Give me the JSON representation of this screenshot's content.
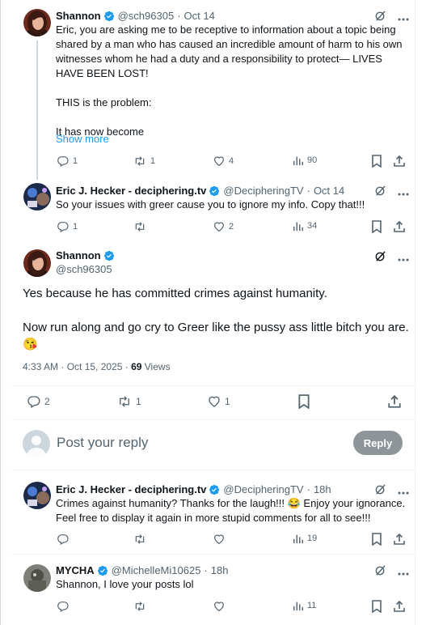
{
  "tweets": [
    {
      "name": "Shannon",
      "handle": "@sch96305",
      "dot": "·",
      "time": "Oct 14",
      "text": "Eric, you are asking me to be receptive to information about a topic being\nshared by a man who has caused an incredible amount of harm to his own\nwitnesses whom he had a duty and a responsibility to protect— LIVES\nHAVE BEEN LOST!\n\nTHIS is the problem:\n\nIt has now become",
      "show_more": "Show more",
      "replies": "1",
      "retweets": "1",
      "likes": "4",
      "views": "90"
    },
    {
      "name": "Eric J. Hecker - deciphering.tv",
      "handle": "@DecipheringTV",
      "dot": "·",
      "time": "Oct 14",
      "text": "So your issues with greer cause you to ignore my info. Copy that!!!",
      "replies": "1",
      "retweets": "",
      "likes": "2",
      "views": "34"
    }
  ],
  "focus": {
    "name": "Shannon",
    "handle": "@sch96305",
    "text": "Yes because he has committed crimes against humanity.\n\nNow run along and go cry to Greer like the pussy ass little bitch you are.",
    "emoji": "😘",
    "timestamp": "4:33 AM · Oct 15, 2025 · ",
    "views_count": "69",
    "views_label": " Views",
    "replies": "2",
    "retweets": "1",
    "likes": "1"
  },
  "reply_box": {
    "placeholder": "Post your reply",
    "button": "Reply"
  },
  "replies": [
    {
      "name": "Eric J. Hecker - deciphering.tv",
      "handle": "@DecipheringTV",
      "dot": "·",
      "time": "18h",
      "text": "Crimes against humanity? Thanks for the laugh!!! 😂 Enjoy your ignorance.\nFeel free to display it again in more stupid comments for all to see!!!",
      "views": "19"
    },
    {
      "name": "MYCHA",
      "handle": "@MichelleMi10625",
      "dot": "·",
      "time": "18h",
      "text": "Shannon, I love your posts lol",
      "views": "11"
    }
  ],
  "colors": {
    "accent": "#1d9bf0",
    "verified": "#1d9bf0",
    "secondary_text": "#536471",
    "reply_button": "#8e9599"
  },
  "icons": [
    "more-icon",
    "grok-icon",
    "reply-icon",
    "retweet-icon",
    "like-icon",
    "views-icon",
    "bookmark-icon",
    "share-icon",
    "verified-icon"
  ]
}
